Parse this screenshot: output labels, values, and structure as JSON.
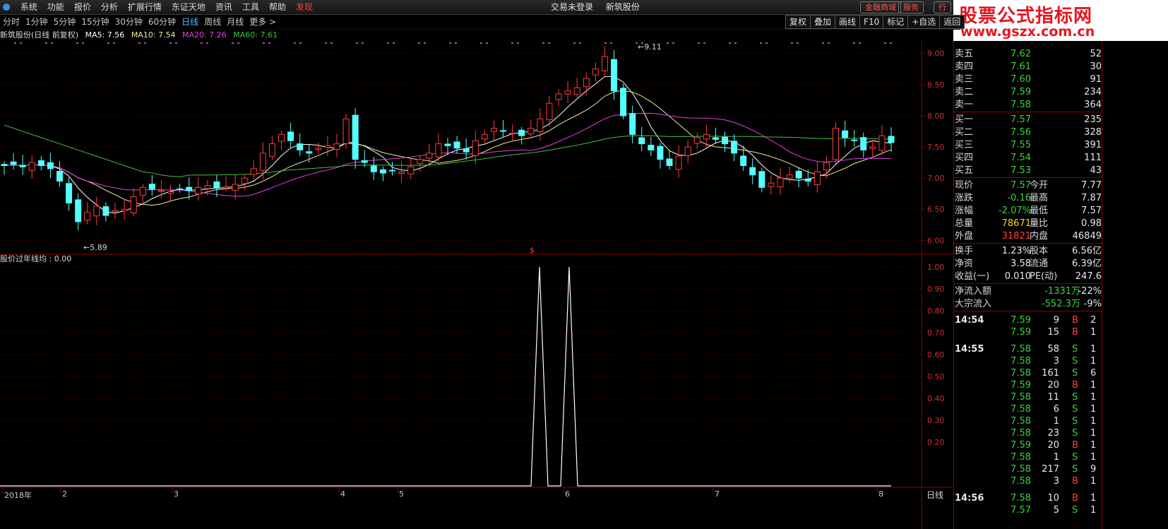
{
  "menu": [
    "系统",
    "功能",
    "报价",
    "分析",
    "扩展行情",
    "东证天地",
    "资讯",
    "工具",
    "帮助"
  ],
  "menu_alert": "发现",
  "center": {
    "login": "交易未登录",
    "stock": "新筑股份"
  },
  "top_buttons": [
    "金融商城",
    "服务",
    "行"
  ],
  "periods": [
    "分时",
    "1分钟",
    "5分钟",
    "15分钟",
    "30分钟",
    "60分钟",
    "日线",
    "周线",
    "月线",
    "更多 >"
  ],
  "active_period": "日线",
  "tool_buttons": [
    "复权",
    "叠加",
    "画线",
    "F10",
    "标记",
    "+自选",
    "返回"
  ],
  "legend": {
    "name": "新筑股份(日线 前复权)",
    "ma5": "MA5: 7.56",
    "ma10": "MA10: 7.54",
    "ma20": "MA20: 7.26",
    "ma60": "MA60: 7.61",
    "colors": {
      "ma5": "#ffffff",
      "ma10": "#e8e8a0",
      "ma20": "#e040e0",
      "ma60": "#40c040"
    }
  },
  "chart_data": {
    "type": "candlestick",
    "y_axis": [
      "9.00",
      "8.50",
      "8.00",
      "7.50",
      "7.00",
      "6.50",
      "6.00"
    ],
    "ylim": [
      5.8,
      9.2
    ],
    "high_label": "9.11",
    "low_label": "5.89",
    "x_labels": [
      "2018年",
      "2",
      "3",
      "4",
      "5",
      "6",
      "7",
      "8"
    ],
    "up_color": "#ff3c3c",
    "down_color": "#54ffff"
  },
  "indicator": {
    "title": "股价过年线均 : 0.00",
    "y_axis": [
      "1.00",
      "0.90",
      "0.80",
      "0.70",
      "0.60",
      "0.50",
      "0.40",
      "0.30",
      "0.20"
    ],
    "ylim": [
      0,
      1
    ]
  },
  "sep_marker": "$",
  "period_label": "日线",
  "watermark": {
    "line1": "股票公式指标网",
    "line2": "www.gszx.com.cn"
  },
  "order_book": {
    "asks": [
      {
        "label": "卖五",
        "price": "7.62",
        "vol": "52"
      },
      {
        "label": "卖四",
        "price": "7.61",
        "vol": "30"
      },
      {
        "label": "卖三",
        "price": "7.60",
        "vol": "91"
      },
      {
        "label": "卖二",
        "price": "7.59",
        "vol": "234"
      },
      {
        "label": "卖一",
        "price": "7.58",
        "vol": "364"
      }
    ],
    "bids": [
      {
        "label": "买一",
        "price": "7.57",
        "vol": "235"
      },
      {
        "label": "买二",
        "price": "7.56",
        "vol": "328"
      },
      {
        "label": "买三",
        "price": "7.55",
        "vol": "391"
      },
      {
        "label": "买四",
        "price": "7.54",
        "vol": "111"
      },
      {
        "label": "买五",
        "price": "7.53",
        "vol": "43"
      }
    ]
  },
  "quote": [
    {
      "l1": "现价",
      "v1": "7.57",
      "c1": "g",
      "l2": "今开",
      "v2": "7.77",
      "c2": "rd"
    },
    {
      "l1": "涨跌",
      "v1": "-0.16",
      "c1": "g",
      "l2": "最高",
      "v2": "7.87",
      "c2": "rd"
    },
    {
      "l1": "涨幅",
      "v1": "-2.07%",
      "c1": "g",
      "l2": "最低",
      "v2": "7.57",
      "c2": "g"
    },
    {
      "l1": "总量",
      "v1": "78671",
      "c1": "y",
      "l2": "量比",
      "v2": "0.98",
      "c2": "y"
    },
    {
      "l1": "外盘",
      "v1": "31821",
      "c1": "rd",
      "l2": "内盘",
      "v2": "46849",
      "c2": "g"
    }
  ],
  "fund": [
    {
      "l1": "换手",
      "v1": "1.23%",
      "l2": "股本",
      "v2": "6.56亿"
    },
    {
      "l1": "净资",
      "v1": "3.58",
      "l2": "流通",
      "v2": "6.39亿"
    },
    {
      "l1": "收益(一)",
      "v1": "0.010",
      "l2": "PE(动)",
      "v2": "247.6"
    }
  ],
  "flow": [
    {
      "label": "净流入额",
      "v1": "-1331万",
      "v2": "-22%"
    },
    {
      "label": "大宗流入",
      "v1": "-552.3万",
      "v2": "-9%"
    }
  ],
  "ticks": [
    {
      "t": "14:54",
      "p": "7.59",
      "v": "9",
      "bs": "B",
      "n": "2"
    },
    {
      "t": "",
      "p": "7.59",
      "v": "15",
      "bs": "B",
      "n": "1"
    },
    {
      "t": "14:55",
      "p": "7.58",
      "v": "58",
      "bs": "S",
      "n": "1"
    },
    {
      "t": "",
      "p": "7.58",
      "v": "3",
      "bs": "S",
      "n": "1"
    },
    {
      "t": "",
      "p": "7.58",
      "v": "161",
      "bs": "S",
      "n": "6"
    },
    {
      "t": "",
      "p": "7.59",
      "v": "20",
      "bs": "B",
      "n": "1"
    },
    {
      "t": "",
      "p": "7.58",
      "v": "11",
      "bs": "S",
      "n": "1"
    },
    {
      "t": "",
      "p": "7.58",
      "v": "6",
      "bs": "S",
      "n": "1"
    },
    {
      "t": "",
      "p": "7.58",
      "v": "1",
      "bs": "S",
      "n": "1"
    },
    {
      "t": "",
      "p": "7.58",
      "v": "23",
      "bs": "S",
      "n": "1"
    },
    {
      "t": "",
      "p": "7.59",
      "v": "20",
      "bs": "B",
      "n": "1"
    },
    {
      "t": "",
      "p": "7.58",
      "v": "1",
      "bs": "S",
      "n": "1"
    },
    {
      "t": "",
      "p": "7.58",
      "v": "217",
      "bs": "S",
      "n": "9"
    },
    {
      "t": "",
      "p": "7.58",
      "v": "3",
      "bs": "B",
      "n": "1"
    },
    {
      "t": "14:56",
      "p": "7.58",
      "v": "10",
      "bs": "B",
      "n": "1"
    },
    {
      "t": "",
      "p": "7.57",
      "v": "5",
      "bs": "S",
      "n": "1"
    }
  ]
}
